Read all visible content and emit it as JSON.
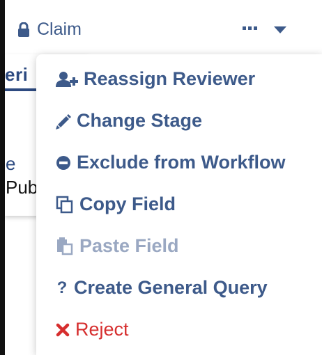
{
  "header": {
    "claim_label": "Claim"
  },
  "background": {
    "tab_fragment": "eri",
    "text_fragment_1": "e",
    "text_fragment_2": "Pub"
  },
  "menu": {
    "items": [
      {
        "label": "Reassign Reviewer",
        "icon": "user-plus-icon"
      },
      {
        "label": "Change Stage",
        "icon": "pencil-icon"
      },
      {
        "label": "Exclude from Workflow",
        "icon": "minus-circle-icon"
      },
      {
        "label": "Copy Field",
        "icon": "copy-icon"
      },
      {
        "label": "Paste Field",
        "icon": "paste-icon",
        "disabled": true
      },
      {
        "label": "Create General Query",
        "icon": "question-icon"
      },
      {
        "label": "Reject",
        "icon": "close-icon"
      }
    ]
  },
  "colors": {
    "primary": "#3d5a8a",
    "disabled": "#9aa8c2",
    "danger": "#d62e2e"
  }
}
